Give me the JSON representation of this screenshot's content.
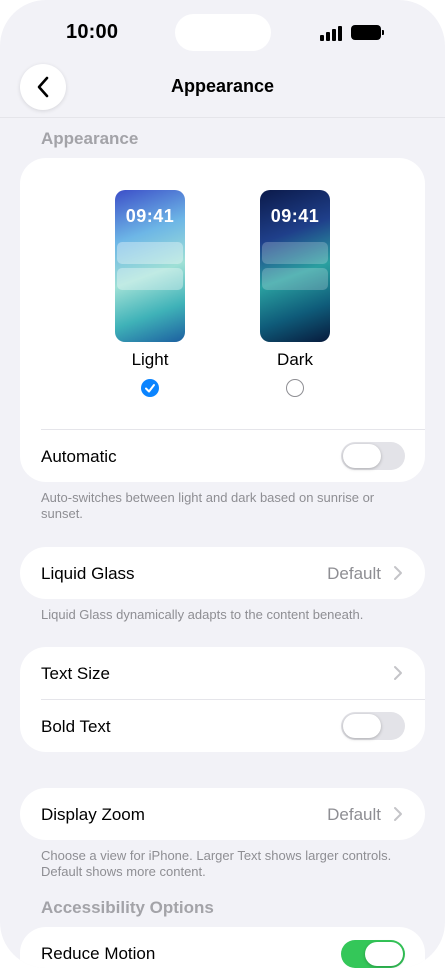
{
  "status_bar": {
    "time": "10:00"
  },
  "nav": {
    "title": "Appearance"
  },
  "appearance_section": {
    "header": "Appearance",
    "options": [
      {
        "label": "Light",
        "preview_time": "09:41",
        "selected": true
      },
      {
        "label": "Dark",
        "preview_time": "09:41",
        "selected": false
      }
    ],
    "automatic": {
      "label": "Automatic",
      "on": false
    },
    "footnote": "Auto-switches between light and dark based on sunrise or sunset."
  },
  "liquid_glass": {
    "label": "Liquid Glass",
    "value": "Default",
    "footnote": "Liquid Glass dynamically adapts to the content beneath."
  },
  "text": {
    "text_size_label": "Text Size",
    "bold_text": {
      "label": "Bold Text",
      "on": false
    }
  },
  "display_zoom": {
    "label": "Display Zoom",
    "value": "Default",
    "footnote": "Choose a view for iPhone. Larger Text shows larger controls. Default shows more content."
  },
  "accessibility": {
    "header": "Accessibility Options",
    "reduce_motion": {
      "label": "Reduce Motion",
      "on": true
    }
  },
  "colors": {
    "accent": "#0a84ff",
    "toggle_on": "#34c759",
    "toggle_off": "#e3e3e8",
    "background": "#f2f2f7"
  }
}
